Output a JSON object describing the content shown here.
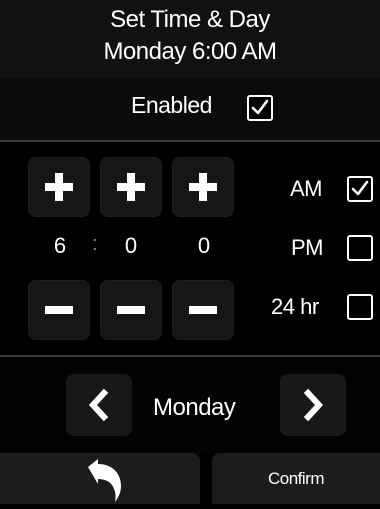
{
  "header": {
    "title": "Set Time & Day",
    "current": "Monday 6:00  AM"
  },
  "enabled": {
    "label": "Enabled",
    "checked": true
  },
  "time": {
    "increment_icon": "plus-icon",
    "decrement_icon": "minus-icon",
    "hour": "6",
    "separator": ":",
    "minute_tens": "0",
    "minute_ones": "0"
  },
  "format": {
    "am": {
      "label": "AM",
      "checked": true
    },
    "pm": {
      "label": "PM",
      "checked": false
    },
    "h24": {
      "label": "24 hr",
      "checked": false
    }
  },
  "day": {
    "prev_icon": "chevron-left-icon",
    "value": "Monday",
    "next_icon": "chevron-right-icon"
  },
  "footer": {
    "back_icon": "undo-arrow-icon",
    "confirm_label": "Confirm"
  },
  "colors": {
    "background": "#000000",
    "tile": "#161616",
    "text": "#ffffff"
  }
}
